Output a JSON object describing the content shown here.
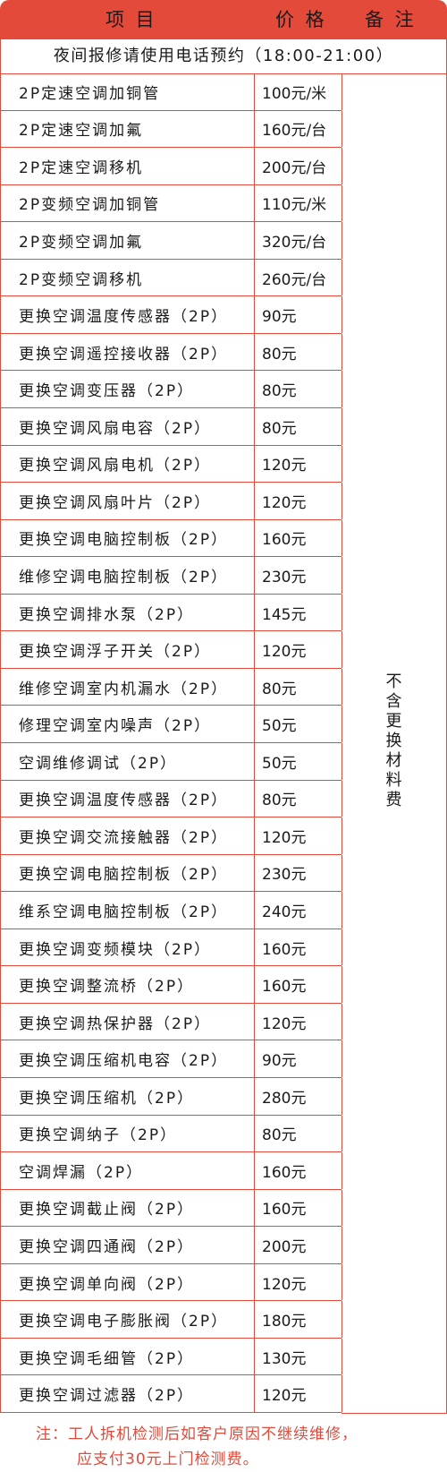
{
  "header": {
    "item": "项 目",
    "price": "价 格",
    "note": "备 注"
  },
  "notice": "夜间报修请使用电话预约（18:00-21:00）",
  "remark": "不含更换材料费",
  "rows": [
    {
      "item": "2P定速空调加铜管",
      "price": "100元/米"
    },
    {
      "item": "2P定速空调加氟",
      "price": "160元/台"
    },
    {
      "item": "2P定速空调移机",
      "price": "200元/台"
    },
    {
      "item": "2P变频空调加铜管",
      "price": "110元/米"
    },
    {
      "item": "2P变频空调加氟",
      "price": "320元/台"
    },
    {
      "item": "2P变频空调移机",
      "price": "260元/台"
    },
    {
      "item": "更换空调温度传感器（2P）",
      "price": "90元"
    },
    {
      "item": "更换空调遥控接收器（2P）",
      "price": "80元"
    },
    {
      "item": "更换空调变压器（2P）",
      "price": "80元"
    },
    {
      "item": "更换空调风扇电容（2P）",
      "price": "80元"
    },
    {
      "item": "更换空调风扇电机（2P）",
      "price": "120元"
    },
    {
      "item": "更换空调风扇叶片（2P）",
      "price": "120元"
    },
    {
      "item": "更换空调电脑控制板（2P）",
      "price": "160元"
    },
    {
      "item": "维修空调电脑控制板（2P）",
      "price": "230元"
    },
    {
      "item": "更换空调排水泵（2P）",
      "price": "145元"
    },
    {
      "item": "更换空调浮子开关（2P）",
      "price": "120元"
    },
    {
      "item": "维修空调室内机漏水（2P）",
      "price": "80元"
    },
    {
      "item": "修理空调室内噪声（2P）",
      "price": "50元"
    },
    {
      "item": "空调维修调试（2P）",
      "price": "50元"
    },
    {
      "item": "更换空调温度传感器（2P）",
      "price": "80元"
    },
    {
      "item": "更换空调交流接触器（2P）",
      "price": "120元"
    },
    {
      "item": "更换空调电脑控制板（2P）",
      "price": "230元"
    },
    {
      "item": "维系空调电脑控制板（2P）",
      "price": "240元"
    },
    {
      "item": "更换空调变频模块（2P）",
      "price": "160元"
    },
    {
      "item": "更换空调整流桥（2P）",
      "price": "160元"
    },
    {
      "item": "更换空调热保护器（2P）",
      "price": "120元"
    },
    {
      "item": "更换空调压缩机电容（2P）",
      "price": "90元"
    },
    {
      "item": "更换空调压缩机（2P）",
      "price": "280元"
    },
    {
      "item": "更换空调纳子（2P）",
      "price": "80元"
    },
    {
      "item": "空调焊漏（2P）",
      "price": "160元"
    },
    {
      "item": "更换空调截止阀（2P）",
      "price": "160元"
    },
    {
      "item": "更换空调四通阀（2P）",
      "price": "200元"
    },
    {
      "item": "更换空调单向阀（2P）",
      "price": "120元"
    },
    {
      "item": "更换空调电子膨胀阀（2P）",
      "price": "180元"
    },
    {
      "item": "更换空调毛细管（2P）",
      "price": "130元"
    },
    {
      "item": "更换空调过滤器（2P）",
      "price": "120元"
    }
  ],
  "footnote": {
    "line1": "注：工人拆机检测后如客户原因不继续维修，",
    "line2": "应支付30元上门检测费。"
  },
  "colors": {
    "accent": "#e34a3a"
  }
}
